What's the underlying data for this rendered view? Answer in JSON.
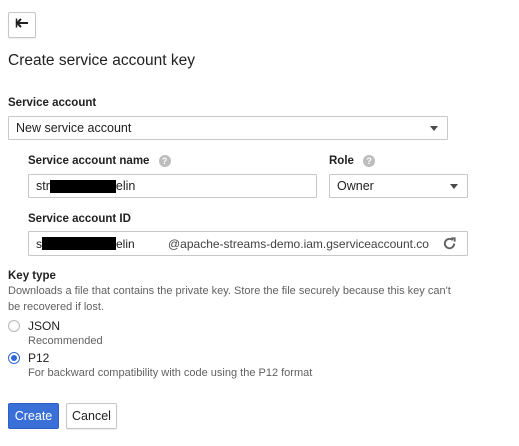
{
  "header": {
    "back_icon": "back-arrow-icon"
  },
  "title": "Create service account key",
  "service_account": {
    "label": "Service account",
    "selected": "New service account"
  },
  "details": {
    "name": {
      "label": "Service account name",
      "value_prefix": "str",
      "value_suffix": "elin",
      "help_icon": "help-icon"
    },
    "role": {
      "label": "Role",
      "selected": "Owner",
      "help_icon": "help-icon"
    },
    "account_id": {
      "label": "Service account ID",
      "value_prefix": "s",
      "value_suffix": "elin",
      "domain": "@apache-streams-demo.iam.gserviceaccount.co",
      "refresh_icon": "refresh-icon"
    }
  },
  "key_type": {
    "label": "Key type",
    "description": "Downloads a file that contains the private key. Store the file securely because this key can't be recovered if lost.",
    "options": [
      {
        "label": "JSON",
        "desc": "Recommended",
        "checked": false
      },
      {
        "label": "P12",
        "desc": "For backward compatibility with code using the P12 format",
        "checked": true
      }
    ]
  },
  "actions": {
    "create": "Create",
    "cancel": "Cancel"
  },
  "colors": {
    "primary": "#3a6fd8",
    "radio_selected": "#3367d6"
  }
}
